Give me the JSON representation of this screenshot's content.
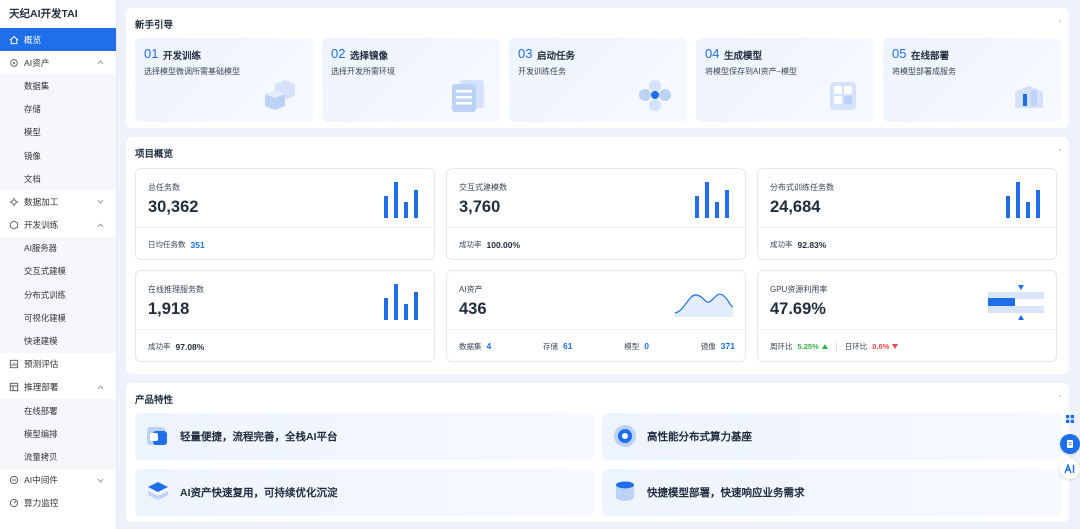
{
  "app": {
    "title": "天纪AI开发TAI"
  },
  "sidebar": {
    "overview": "概览",
    "ai_assets": {
      "label": "AI资产",
      "items": [
        "数据集",
        "存储",
        "模型",
        "镜像",
        "文档"
      ]
    },
    "data_processing": "数据加工",
    "dev_training": {
      "label": "开发训练",
      "items": [
        "AI服务器",
        "交互式建模",
        "分布式训练",
        "可视化建模",
        "快速建模"
      ]
    },
    "prediction": "预测评估",
    "inference": {
      "label": "推理部署",
      "items": [
        "在线部署",
        "模型编排",
        "流量拷贝"
      ]
    },
    "middleware": "AI中间件",
    "compute": "算力监控"
  },
  "guide": {
    "title": "新手引导",
    "steps": [
      {
        "num": "01",
        "title": "开发训练",
        "desc": "选择模型微调所需基础模型"
      },
      {
        "num": "02",
        "title": "选择镜像",
        "desc": "选择开发所需环境"
      },
      {
        "num": "03",
        "title": "启动任务",
        "desc": "开发训练任务"
      },
      {
        "num": "04",
        "title": "生成模型",
        "desc": "将模型保存到AI资产–模型"
      },
      {
        "num": "05",
        "title": "在线部署",
        "desc": "将模型部署成服务"
      }
    ]
  },
  "overview": {
    "title": "项目概览",
    "total_tasks": {
      "label": "总任务数",
      "value": "30,362",
      "foot_label": "日均任务数",
      "foot_value": "351"
    },
    "interactive": {
      "label": "交互式建模数",
      "value": "3,760",
      "foot_label": "成功率",
      "foot_value": "100.00%"
    },
    "distributed": {
      "label": "分布式训练任务数",
      "value": "24,684",
      "foot_label": "成功率",
      "foot_value": "92.83%"
    },
    "online": {
      "label": "在线推理服务数",
      "value": "1,918",
      "foot_label": "成功率",
      "foot_value": "97.08%"
    },
    "assets": {
      "label": "AI资产",
      "value": "436",
      "parts": [
        {
          "label": "数据集",
          "value": "4"
        },
        {
          "label": "存储",
          "value": "61"
        },
        {
          "label": "模型",
          "value": "0"
        },
        {
          "label": "镜像",
          "value": "371"
        }
      ]
    },
    "gpu": {
      "label": "GPU资源利用率",
      "value": "47.69%",
      "level": 0.4769,
      "wow_label": "周环比",
      "wow_value": "5.25%",
      "dod_label": "日环比",
      "dod_value": "0.6%",
      "up_color": "#2fb344",
      "down_color": "#e5484d"
    }
  },
  "features": {
    "title": "产品特性",
    "items": [
      "轻量便捷，流程完善，全栈AI平台",
      "高性能分布式算力基座",
      "AI资产快速复用，可持续优化沉淀",
      "快捷模型部署，快速响应业务需求"
    ]
  },
  "theme": {
    "accent": "#1f6feb"
  }
}
